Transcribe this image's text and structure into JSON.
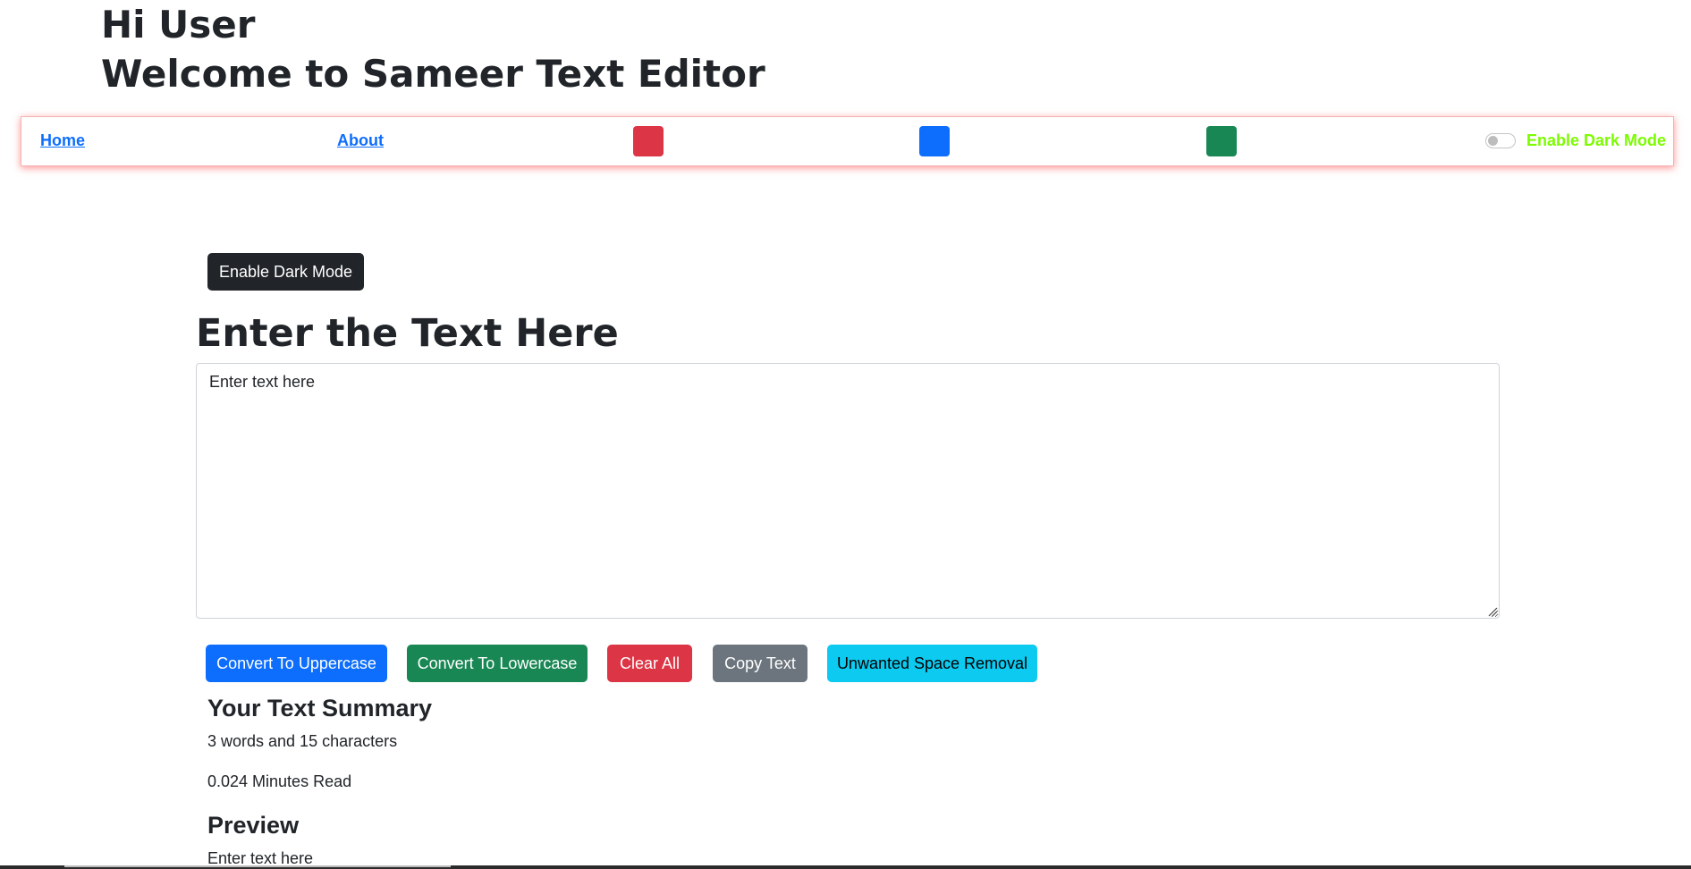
{
  "header": {
    "greeting": "Hi User",
    "welcome": "Welcome to Sameer Text Editor"
  },
  "navbar": {
    "links": [
      "Home",
      "About"
    ],
    "color_swatches": [
      "#dc3545",
      "#0d6efd",
      "#198754"
    ],
    "toggle_label": "Enable Dark Mode",
    "toggle_checked": false,
    "toggle_label_color": "#7cfc00"
  },
  "main": {
    "dark_mode_button": "Enable Dark Mode",
    "heading": "Enter the Text Here",
    "textarea_placeholder": "Enter text here",
    "textarea_value": "",
    "buttons": [
      {
        "label": "Convert To Uppercase",
        "color": "#0d6efd"
      },
      {
        "label": "Convert To Lowercase",
        "color": "#198754"
      },
      {
        "label": "Clear All",
        "color": "#dc3545"
      },
      {
        "label": "Copy Text",
        "color": "#6c757d"
      },
      {
        "label": "Unwanted Space Removal",
        "color": "#0dcaf0"
      }
    ]
  },
  "summary": {
    "heading": "Your Text Summary",
    "word_char_count": "3 words and 15 characters",
    "read_time": "0.024 Minutes Read",
    "preview_heading": "Preview",
    "preview_text": "Enter text here"
  }
}
